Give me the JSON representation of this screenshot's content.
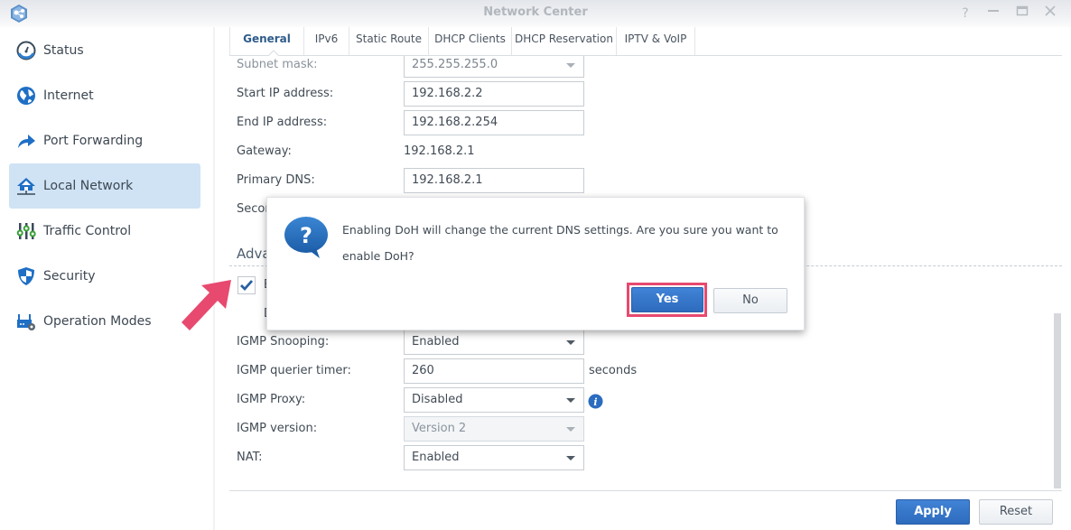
{
  "window": {
    "title": "Network Center",
    "controls": [
      "help",
      "minimize",
      "maximize",
      "close"
    ]
  },
  "sidebar": {
    "items": [
      {
        "label": "Status",
        "icon": "speedometer-icon",
        "active": false
      },
      {
        "label": "Internet",
        "icon": "globe-icon",
        "active": false
      },
      {
        "label": "Port Forwarding",
        "icon": "forward-arrow-icon",
        "active": false
      },
      {
        "label": "Local Network",
        "icon": "home-network-icon",
        "active": true
      },
      {
        "label": "Traffic Control",
        "icon": "sliders-icon",
        "active": false
      },
      {
        "label": "Security",
        "icon": "shield-icon",
        "active": false
      },
      {
        "label": "Operation Modes",
        "icon": "router-gear-icon",
        "active": false
      }
    ]
  },
  "tabs": [
    {
      "label": "General",
      "active": true
    },
    {
      "label": "IPv6",
      "active": false
    },
    {
      "label": "Static Route",
      "active": false
    },
    {
      "label": "DHCP Clients",
      "active": false
    },
    {
      "label": "DHCP Reservation",
      "active": false
    },
    {
      "label": "IPTV & VoIP",
      "active": false
    }
  ],
  "form": {
    "subnet_mask": {
      "label": "Subnet mask:",
      "value": "255.255.255.0"
    },
    "start_ip": {
      "label": "Start IP address:",
      "value": "192.168.2.2"
    },
    "end_ip": {
      "label": "End IP address:",
      "value": "192.168.2.254"
    },
    "gateway": {
      "label": "Gateway:",
      "value": "192.168.2.1"
    },
    "primary_dns": {
      "label": "Primary DNS:",
      "value": "192.168.2.1"
    },
    "secondary_dns": {
      "label": "Secor"
    },
    "advanced_title": "Adva",
    "doh_checkbox": {
      "checked": true,
      "label_fragment": "E"
    },
    "doh_sub_fragment": "D",
    "igmp_snooping": {
      "label": "IGMP Snooping:",
      "value": "Enabled"
    },
    "igmp_querier_timer": {
      "label": "IGMP querier timer:",
      "value": "260",
      "unit": "seconds"
    },
    "igmp_proxy": {
      "label": "IGMP Proxy:",
      "value": "Disabled"
    },
    "igmp_version": {
      "label": "IGMP version:",
      "value": "Version 2"
    },
    "nat": {
      "label": "NAT:",
      "value": "Enabled"
    }
  },
  "footer": {
    "apply_label": "Apply",
    "reset_label": "Reset"
  },
  "dialog": {
    "message_line1": "Enabling DoH will change the current DNS settings. Are you sure you want to",
    "message_line2": "enable DoH?",
    "yes_label": "Yes",
    "no_label": "No"
  },
  "colors": {
    "accent": "#2d6bbd",
    "active_nav_bg": "#cfe3f5",
    "annotation": "#e8496f"
  }
}
